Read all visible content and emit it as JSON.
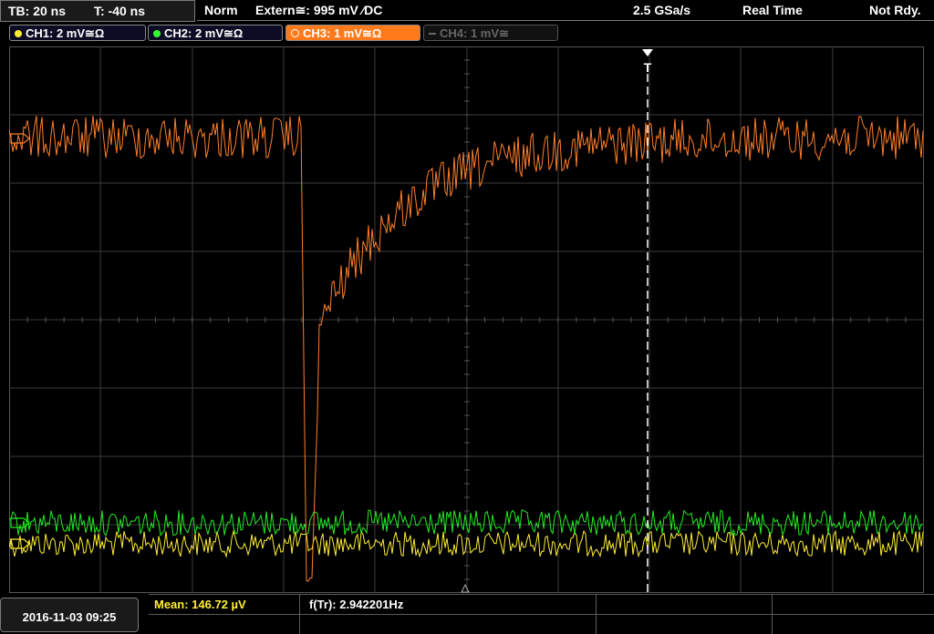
{
  "timebase": {
    "tb": "TB: 20 ns",
    "trig_time": "T: -40 ns"
  },
  "header": {
    "mode": "Norm",
    "trigger": "Extern≅: 995 mV ⁄DC",
    "sample_rate": "2.5 GSa/s",
    "acq": "Real Time",
    "status": "Not Rdy."
  },
  "channels": [
    {
      "label": "CH1: 2 mV≅Ω",
      "color": "#ffee33",
      "state": "on"
    },
    {
      "label": "CH2: 2 mV≅Ω",
      "color": "#33ff33",
      "state": "on"
    },
    {
      "label": "CH3: 1 mV≅Ω",
      "color": "#ff7a1a",
      "state": "active"
    },
    {
      "label": "CH4: 1 mV≅",
      "color": "#777777",
      "state": "off"
    }
  ],
  "trigger_marker": "T",
  "colors": {
    "ch1": "#ffee33",
    "ch2": "#22ee22",
    "ch3": "#ff7f2a",
    "grid": "#3c3c3c"
  },
  "footer": {
    "date": "2016-11-03 09:25",
    "mean": "Mean: 146.72 µV",
    "freq": "f(Tr): 2.942201Hz"
  }
}
